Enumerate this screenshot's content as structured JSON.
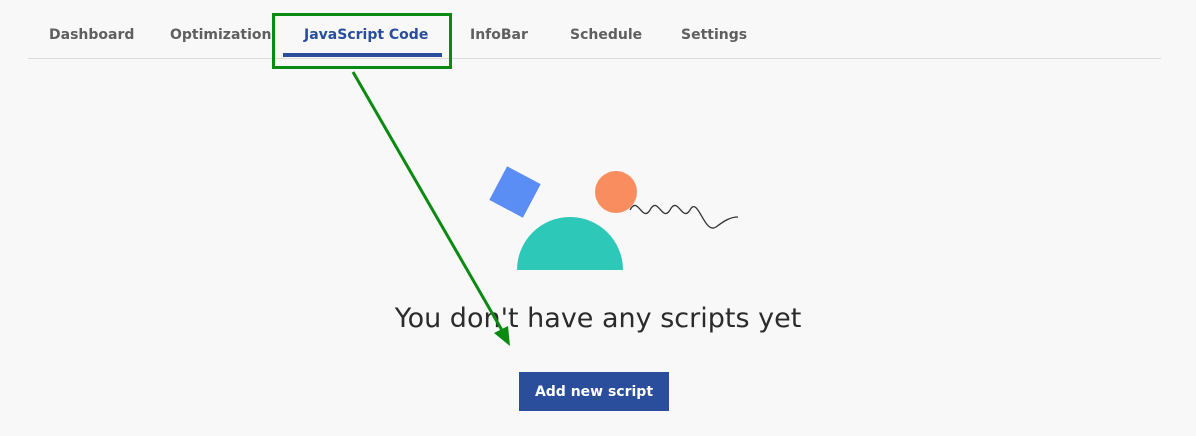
{
  "tabs": [
    {
      "label": "Dashboard",
      "active": false
    },
    {
      "label": "Optimization",
      "active": false
    },
    {
      "label": "JavaScript Code",
      "active": true
    },
    {
      "label": "InfoBar",
      "active": false
    },
    {
      "label": "Schedule",
      "active": false
    },
    {
      "label": "Settings",
      "active": false
    }
  ],
  "empty_state": {
    "message": "You don't have any scripts yet",
    "add_button_label": "Add new script"
  },
  "colors": {
    "accent": "#2a4e9c",
    "annotation_green": "#0a8a10",
    "square_blue": "#5b8ef5",
    "circle_orange": "#f98d5f",
    "semicircle_teal": "#2ec8b9"
  },
  "icons": [
    "empty-state-illustration"
  ]
}
